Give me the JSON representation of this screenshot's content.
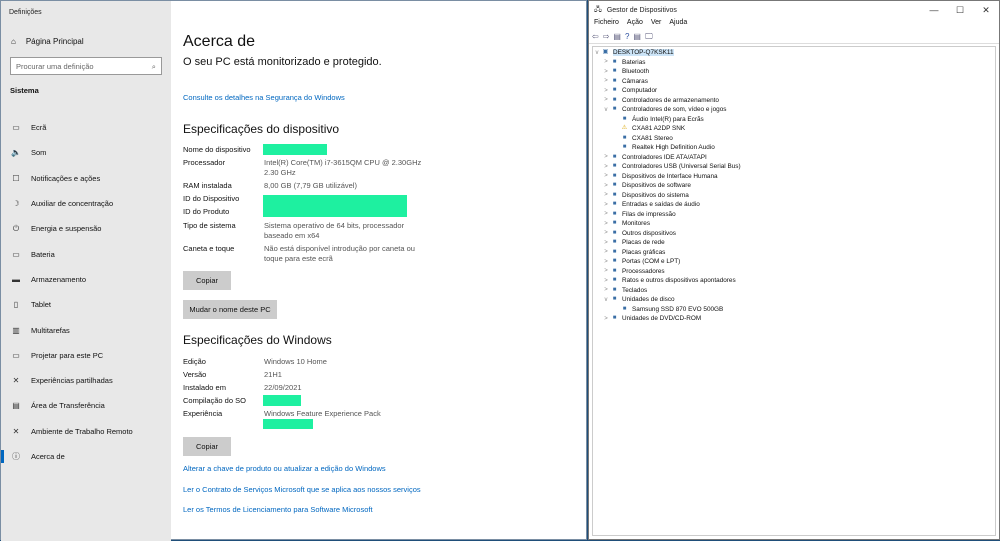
{
  "settings": {
    "window_title": "Definições",
    "home": "Página Principal",
    "search_placeholder": "Procurar uma definição",
    "section": "Sistema",
    "nav": [
      {
        "label": "Ecrã",
        "icon": "monitor-icon"
      },
      {
        "label": "Som",
        "icon": "speaker-icon"
      },
      {
        "label": "Notificações e ações",
        "icon": "notification-icon"
      },
      {
        "label": "Auxiliar de concentração",
        "icon": "moon-icon"
      },
      {
        "label": "Energia e suspensão",
        "icon": "power-icon"
      },
      {
        "label": "Bateria",
        "icon": "battery-icon"
      },
      {
        "label": "Armazenamento",
        "icon": "storage-icon"
      },
      {
        "label": "Tablet",
        "icon": "tablet-icon"
      },
      {
        "label": "Multitarefas",
        "icon": "multitask-icon"
      },
      {
        "label": "Projetar para este PC",
        "icon": "project-icon"
      },
      {
        "label": "Experiências partilhadas",
        "icon": "share-icon"
      },
      {
        "label": "Área de Transferência",
        "icon": "clipboard-icon"
      },
      {
        "label": "Ambiente de Trabalho Remoto",
        "icon": "remote-icon"
      },
      {
        "label": "Acerca de",
        "icon": "info-icon",
        "selected": true
      }
    ],
    "title": "Acerca de",
    "protection": "O seu PC está monitorizado e protegido.",
    "security_link": "Consulte os detalhes na Segurança do Windows",
    "device_specs_title": "Especificações do dispositivo",
    "device_specs": [
      {
        "k": "Nome do dispositivo",
        "v": ""
      },
      {
        "k": "Processador",
        "v": "Intel(R) Core(TM) i7-3615QM CPU @ 2.30GHz 2.30 GHz"
      },
      {
        "k": "RAM instalada",
        "v": "8,00 GB (7,79 GB utilizável)"
      },
      {
        "k": "ID do Dispositivo",
        "v": ""
      },
      {
        "k": "ID do Produto",
        "v": ""
      },
      {
        "k": "Tipo de sistema",
        "v": "Sistema operativo de 64 bits, processador baseado em x64"
      },
      {
        "k": "Caneta e toque",
        "v": "Não está disponível introdução por caneta ou toque para este ecrã"
      }
    ],
    "copy_label": "Copiar",
    "rename_label": "Mudar o nome deste PC",
    "windows_specs_title": "Especificações do Windows",
    "windows_specs": [
      {
        "k": "Edição",
        "v": "Windows 10 Home"
      },
      {
        "k": "Versão",
        "v": "21H1"
      },
      {
        "k": "Instalado em",
        "v": "22/09/2021"
      },
      {
        "k": "Compilação do SO",
        "v": ""
      },
      {
        "k": "Experiência",
        "v": "Windows Feature Experience Pack"
      }
    ],
    "links": [
      "Alterar a chave de produto ou atualizar a edição do Windows",
      "Ler o Contrato de Serviços Microsoft que se aplica aos nossos serviços",
      "Ler os Termos de Licenciamento para Software Microsoft"
    ],
    "redaction_color": "#1ef0a0",
    "accent": "#0067c0"
  },
  "devmgr": {
    "title": "Gestor de Dispositivos",
    "menu": [
      "Ficheiro",
      "Ação",
      "Ver",
      "Ajuda"
    ],
    "root": "DESKTOP-Q7KSK11",
    "tree": [
      {
        "label": "Baterias",
        "level": 1,
        "exp": ">"
      },
      {
        "label": "Bluetooth",
        "level": 1,
        "exp": ">"
      },
      {
        "label": "Câmaras",
        "level": 1,
        "exp": ">"
      },
      {
        "label": "Computador",
        "level": 1,
        "exp": ">"
      },
      {
        "label": "Controladores de armazenamento",
        "level": 1,
        "exp": ">"
      },
      {
        "label": "Controladores de som, vídeo e jogos",
        "level": 1,
        "exp": "v"
      },
      {
        "label": "Áudio Intel(R) para Ecrãs",
        "level": 2
      },
      {
        "label": "CXA81 A2DP SNK",
        "level": 2,
        "warning": true
      },
      {
        "label": "CXA81 Stereo",
        "level": 2
      },
      {
        "label": "Realtek High Definition Audio",
        "level": 2
      },
      {
        "label": "Controladores IDE ATA/ATAPI",
        "level": 1,
        "exp": ">"
      },
      {
        "label": "Controladores USB (Universal Serial Bus)",
        "level": 1,
        "exp": ">"
      },
      {
        "label": "Dispositivos de Interface Humana",
        "level": 1,
        "exp": ">"
      },
      {
        "label": "Dispositivos de software",
        "level": 1,
        "exp": ">"
      },
      {
        "label": "Dispositivos do sistema",
        "level": 1,
        "exp": ">"
      },
      {
        "label": "Entradas e saídas de áudio",
        "level": 1,
        "exp": ">"
      },
      {
        "label": "Filas de impressão",
        "level": 1,
        "exp": ">"
      },
      {
        "label": "Monitores",
        "level": 1,
        "exp": ">"
      },
      {
        "label": "Outros dispositivos",
        "level": 1,
        "exp": ">"
      },
      {
        "label": "Placas de rede",
        "level": 1,
        "exp": ">"
      },
      {
        "label": "Placas gráficas",
        "level": 1,
        "exp": ">"
      },
      {
        "label": "Portas (COM e LPT)",
        "level": 1,
        "exp": ">"
      },
      {
        "label": "Processadores",
        "level": 1,
        "exp": ">"
      },
      {
        "label": "Ratos e outros dispositivos apontadores",
        "level": 1,
        "exp": ">"
      },
      {
        "label": "Teclados",
        "level": 1,
        "exp": ">"
      },
      {
        "label": "Unidades de disco",
        "level": 1,
        "exp": "v"
      },
      {
        "label": "Samsung SSD 870 EVO 500GB",
        "level": 2
      },
      {
        "label": "Unidades de DVD/CD-ROM",
        "level": 1,
        "exp": ">"
      }
    ]
  }
}
